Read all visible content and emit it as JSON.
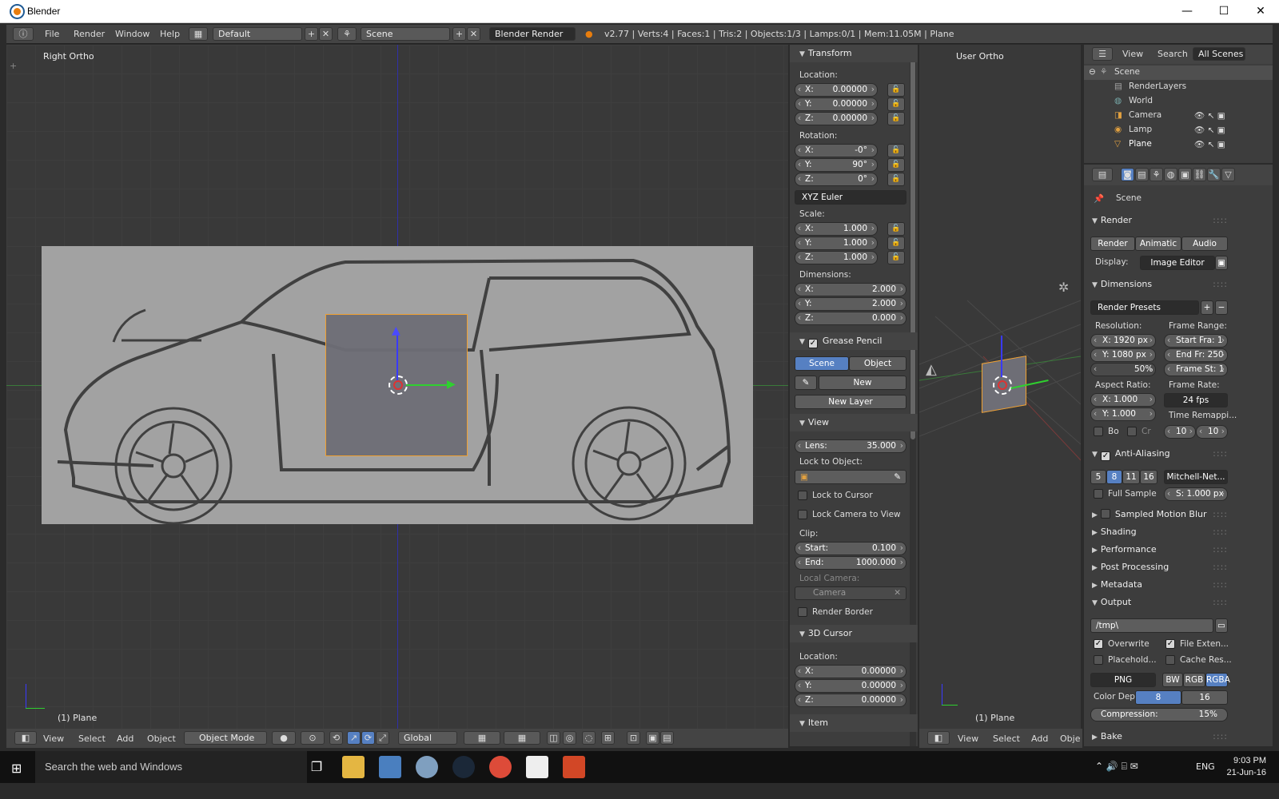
{
  "window": {
    "title": "Blender"
  },
  "info": {
    "menus": [
      "File",
      "Render",
      "Window",
      "Help"
    ],
    "layout": "Default",
    "scene": "Scene",
    "engine": "Blender Render",
    "stats": "v2.77 | Verts:4 | Faces:1 | Tris:2 | Objects:1/3 | Lamps:0/1 | Mem:11.05M | Plane"
  },
  "left_view": {
    "label": "Right Ortho",
    "object_label": "(1) Plane"
  },
  "right_view": {
    "label": "User Ortho",
    "object_label": "(1) Plane"
  },
  "transform": {
    "title": "Transform",
    "location_label": "Location:",
    "location": [
      {
        "k": "X:",
        "v": "0.00000"
      },
      {
        "k": "Y:",
        "v": "0.00000"
      },
      {
        "k": "Z:",
        "v": "0.00000"
      }
    ],
    "rotation_label": "Rotation:",
    "rotation": [
      {
        "k": "X:",
        "v": "-0°"
      },
      {
        "k": "Y:",
        "v": "90°"
      },
      {
        "k": "Z:",
        "v": "0°"
      }
    ],
    "rotation_mode": "XYZ Euler",
    "scale_label": "Scale:",
    "scale": [
      {
        "k": "X:",
        "v": "1.000"
      },
      {
        "k": "Y:",
        "v": "1.000"
      },
      {
        "k": "Z:",
        "v": "1.000"
      }
    ],
    "dimensions_label": "Dimensions:",
    "dimensions": [
      {
        "k": "X:",
        "v": "2.000"
      },
      {
        "k": "Y:",
        "v": "2.000"
      },
      {
        "k": "Z:",
        "v": "0.000"
      }
    ]
  },
  "grease": {
    "title": "Grease Pencil",
    "scene": "Scene",
    "object": "Object",
    "new": "New",
    "new_layer": "New Layer"
  },
  "view": {
    "title": "View",
    "lens_k": "Lens:",
    "lens_v": "35.000",
    "lock_obj": "Lock to Object:",
    "lock_cursor": "Lock to Cursor",
    "lock_camera": "Lock Camera to View",
    "clip": "Clip:",
    "start_k": "Start:",
    "start_v": "0.100",
    "end_k": "End:",
    "end_v": "1000.000",
    "local_camera": "Local Camera:",
    "camera": "Camera",
    "render_border": "Render Border"
  },
  "cursor": {
    "title": "3D Cursor",
    "location_label": "Location:",
    "location": [
      {
        "k": "X:",
        "v": "0.00000"
      },
      {
        "k": "Y:",
        "v": "0.00000"
      },
      {
        "k": "Z:",
        "v": "0.00000"
      }
    ]
  },
  "item": {
    "title": "Item"
  },
  "bottom": {
    "view": "View",
    "select": "Select",
    "add": "Add",
    "object": "Object",
    "mode": "Object Mode",
    "orient": "Global",
    "object_short": "Objec"
  },
  "outliner": {
    "menus": [
      "View",
      "Search"
    ],
    "all_scenes": "All Scenes",
    "items": [
      "Scene",
      "RenderLayers",
      "World",
      "Camera",
      "Lamp",
      "Plane"
    ]
  },
  "props": {
    "context": "Scene",
    "render_title": "Render",
    "render_btns": [
      "Render",
      "Animatic",
      "Audio"
    ],
    "display_label": "Display:",
    "display": "Image Editor",
    "dimensions_title": "Dimensions",
    "presets": "Render Presets",
    "resolution_label": "Resolution:",
    "res_x": "X: 1920 px",
    "res_y": "Y: 1080 px",
    "res_pct": "50%",
    "frame_range_label": "Frame Range:",
    "start_fra": "Start Fra: 1",
    "end_fr": "End Fr: 250",
    "frame_st": "Frame St: 1",
    "aspect_label": "Aspect Ratio:",
    "asp_x": "X: 1.000",
    "asp_y": "Y: 1.000",
    "frame_rate_label": "Frame Rate:",
    "fps": "24 fps",
    "time_remap": "Time Remappi...",
    "bo": "Bo",
    "cr": "Cr",
    "remap_a": "10",
    "remap_b": "10",
    "aa_title": "Anti-Aliasing",
    "aa_samples": [
      "5",
      "8",
      "11",
      "16"
    ],
    "aa_filter": "Mitchell-Net...",
    "full_sample": "Full Sample",
    "filter_size": "S: 1.000 px",
    "collapsed": [
      "Sampled Motion Blur",
      "Shading",
      "Performance",
      "Post Processing",
      "Metadata"
    ],
    "output_title": "Output",
    "path": "/tmp\\",
    "overwrite": "Overwrite",
    "file_ext": "File Exten...",
    "placeholder": "Placehold...",
    "cache": "Cache Res...",
    "format": "PNG",
    "color_modes": [
      "BW",
      "RGB",
      "RGBA"
    ],
    "color_depth_label": "Color Dep",
    "depths": [
      "8",
      "16"
    ],
    "compression": "Compression:",
    "compression_v": "15%",
    "bake": "Bake"
  },
  "taskbar": {
    "search": "Search the web and Windows",
    "lang": "ENG",
    "time": "9:03 PM",
    "date": "21-Jun-16"
  }
}
